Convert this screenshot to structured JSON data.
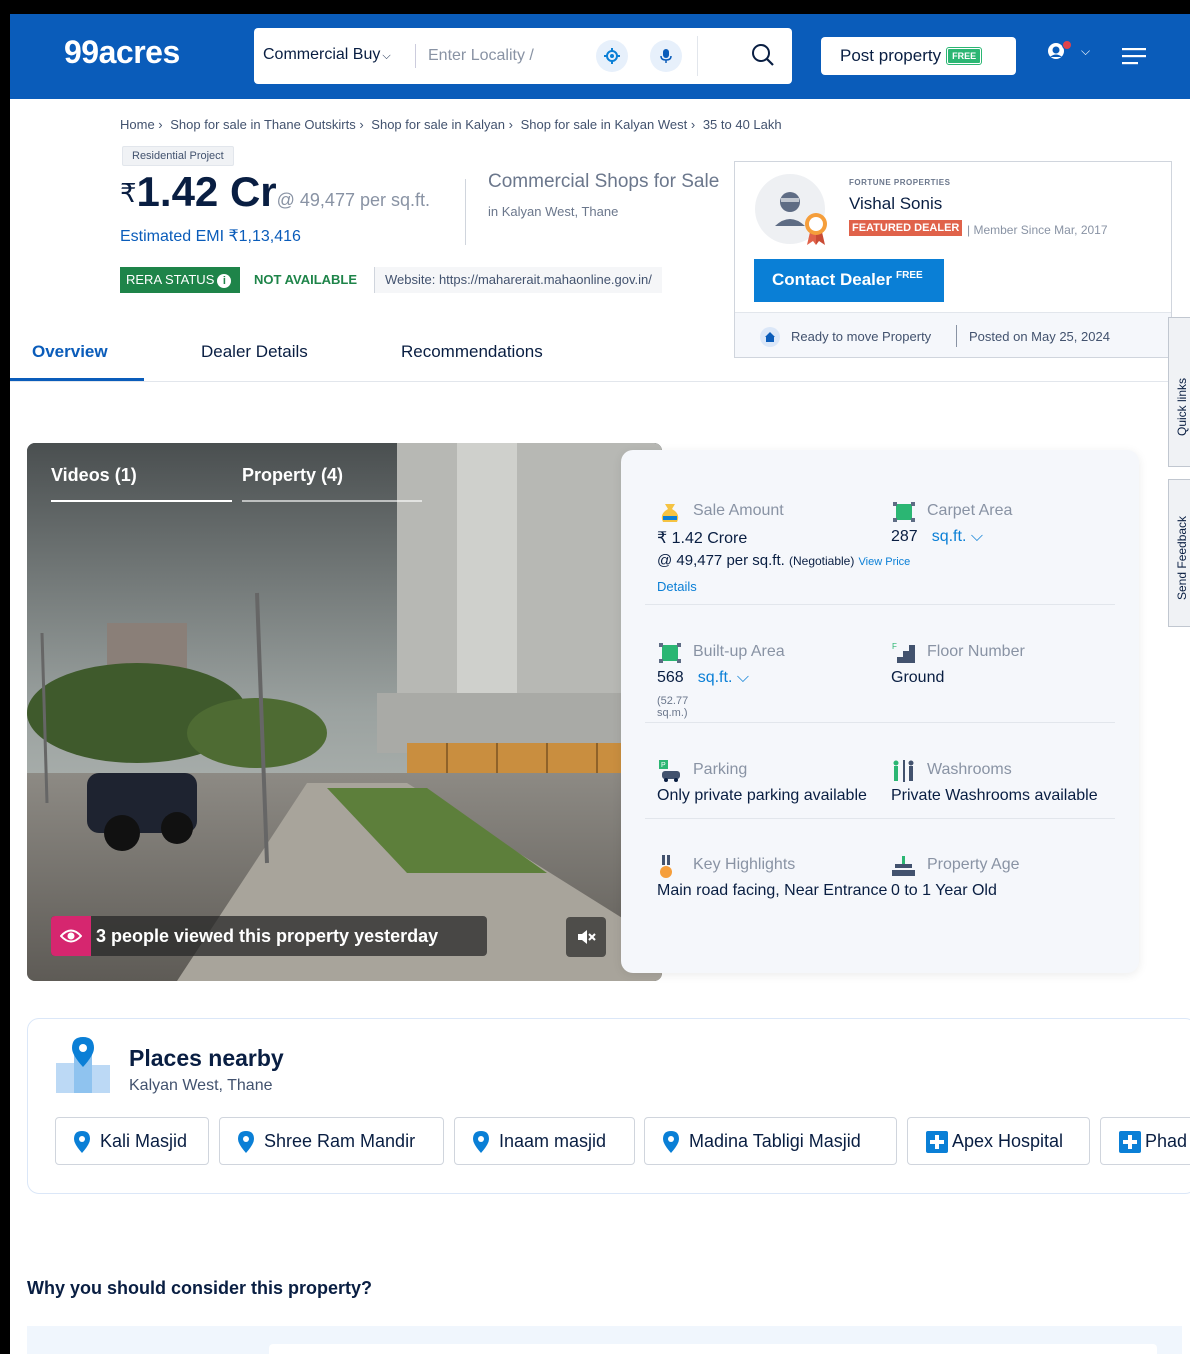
{
  "header": {
    "logo": "99acres",
    "search": {
      "category": "Commercial Buy",
      "placeholder": "Enter Locality /"
    },
    "post_property": "Post property",
    "free_badge": "FREE",
    "icons": [
      "location-target-icon",
      "microphone-icon",
      "search-icon",
      "user-icon",
      "chevron-down-icon",
      "hamburger-menu-icon"
    ]
  },
  "breadcrumb": [
    "Home ›",
    "Shop for sale in Thane Outskirts ›",
    "Shop for sale in Kalyan ›",
    "Shop for sale in Kalyan West ›",
    "35 to 40 Lakh"
  ],
  "listing": {
    "project_tag": "Residential Project",
    "currency": "₹",
    "price": "1.42 Cr",
    "price_per_sqft": "@ 49,477 per sq.ft.",
    "emi": "Estimated EMI ₹1,13,416",
    "title": "Commercial Shops for Sale",
    "location": "in Kalyan West, Thane",
    "rera_label": "RERA STATUS",
    "rera_value": "NOT AVAILABLE",
    "rera_website": "Website: https://maharerait.mahaonline.gov.in/"
  },
  "dealer": {
    "company": "FORTUNE PROPERTIES",
    "name": "Vishal Sonis",
    "featured": "FEATURED DEALER",
    "member_since": "| Member Since Mar, 2017",
    "contact": "Contact Dealer",
    "contact_free": "FREE",
    "ready": "Ready to move Property",
    "posted": "Posted on May 25, 2024"
  },
  "tabs": [
    "Overview",
    "Dealer Details",
    "Recommendations"
  ],
  "side_tabs": [
    "Quick links",
    "Send Feedback"
  ],
  "media": {
    "tabs": [
      "Videos (1)",
      "Property (4)"
    ],
    "viewed": "3 people viewed this property yesterday"
  },
  "details": {
    "sale_amount": {
      "label": "Sale Amount",
      "value": "₹ 1.42 Crore",
      "per": "@ 49,477 per sq.ft.",
      "negotiable": "(Negotiable)",
      "view_price": "View Price",
      "link": "Details"
    },
    "carpet_area": {
      "label": "Carpet Area",
      "value": "287",
      "unit": "sq.ft."
    },
    "builtup_area": {
      "label": "Built-up Area",
      "value": "568",
      "unit": "sq.ft.",
      "sqm": "(52.77 sq.m.)"
    },
    "floor": {
      "label": "Floor Number",
      "value": "Ground"
    },
    "parking": {
      "label": "Parking",
      "value": "Only private parking available"
    },
    "washrooms": {
      "label": "Washrooms",
      "value": "Private Washrooms available"
    },
    "highlights": {
      "label": "Key Highlights",
      "value": "Main road facing, Near Entrance"
    },
    "age": {
      "label": "Property Age",
      "value": "0 to 1 Year Old"
    }
  },
  "places": {
    "title": "Places nearby",
    "subtitle": "Kalyan West, Thane",
    "chips": [
      "Kali Masjid",
      "Shree Ram Mandir",
      "Inaam masjid",
      "Madina Tabligi Masjid",
      "Apex Hospital",
      "Phad"
    ]
  },
  "why": "Why you should consider this property?",
  "colors": {
    "brand": "#0a5cba",
    "rera_green": "#1e8449",
    "viewed_pink": "#d6266f",
    "featured": "#e0624a"
  }
}
